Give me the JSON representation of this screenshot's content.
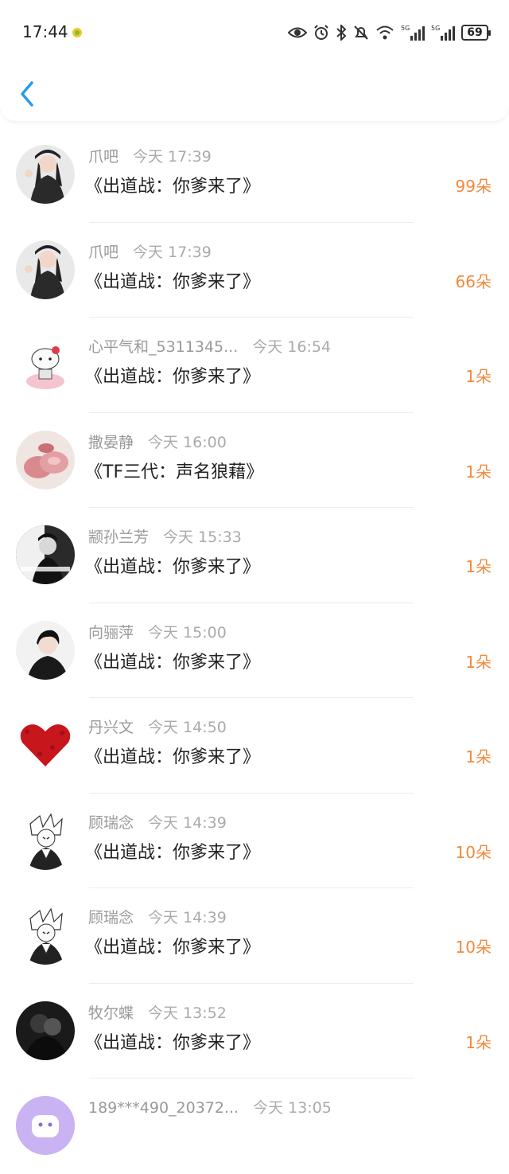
{
  "status_bar": {
    "time": "17:44",
    "emoji_icon": "weather-sun-icon",
    "battery": "69",
    "network1": "5G",
    "network2": "5G",
    "icons": [
      "eye-icon",
      "alarm-icon",
      "bluetooth-icon",
      "mute-icon",
      "wifi-icon",
      "signal-icon",
      "signal-icon",
      "battery-icon"
    ]
  },
  "navbar": {
    "back_icon": "chevron-left-icon",
    "accent": "#2a9be8"
  },
  "colors": {
    "count": "#f08a3c",
    "name": "#999999",
    "title": "#222222"
  },
  "items": [
    {
      "name": "爪吧",
      "time": "今天 17:39",
      "title": "《出道战：你爹来了》",
      "count": "99朵"
    },
    {
      "name": "爪吧",
      "time": "今天 17:39",
      "title": "《出道战：你爹来了》",
      "count": "66朵"
    },
    {
      "name": "心平气和_5311345...",
      "time": "今天 16:54",
      "title": "《出道战：你爹来了》",
      "count": "1朵"
    },
    {
      "name": "撒晏静",
      "time": "今天 16:00",
      "title": "《TF三代：声名狼藉》",
      "count": "1朵"
    },
    {
      "name": "颛孙兰芳",
      "time": "今天 15:33",
      "title": "《出道战：你爹来了》",
      "count": "1朵"
    },
    {
      "name": "向骊萍",
      "time": "今天 15:00",
      "title": "《出道战：你爹来了》",
      "count": "1朵"
    },
    {
      "name": "丹兴文",
      "time": "今天 14:50",
      "title": "《出道战：你爹来了》",
      "count": "1朵"
    },
    {
      "name": "顾瑞念",
      "time": "今天 14:39",
      "title": "《出道战：你爹来了》",
      "count": "10朵"
    },
    {
      "name": "顾瑞念",
      "time": "今天 14:39",
      "title": "《出道战：你爹来了》",
      "count": "10朵"
    },
    {
      "name": "牧尔蝶",
      "time": "今天 13:52",
      "title": "《出道战：你爹来了》",
      "count": "1朵"
    },
    {
      "name": "189***490_20372...",
      "time": "今天 13:05",
      "title": "",
      "count": ""
    }
  ]
}
